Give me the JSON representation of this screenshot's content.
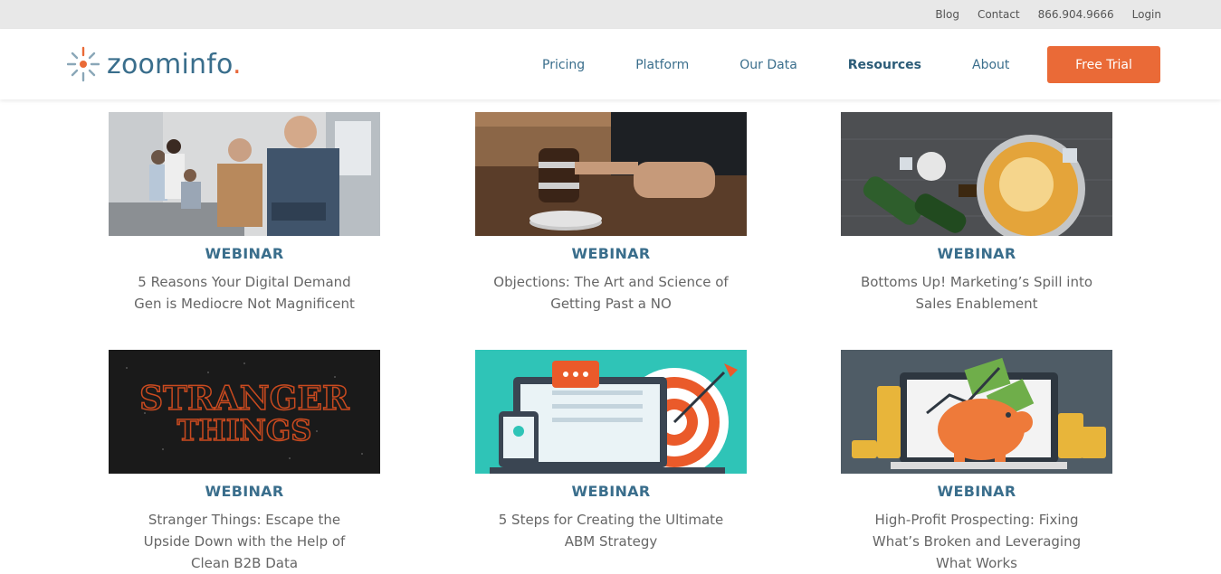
{
  "topbar": {
    "links": [
      {
        "label": "Blog"
      },
      {
        "label": "Contact"
      },
      {
        "label": "866.904.9666"
      },
      {
        "label": "Login"
      }
    ]
  },
  "header": {
    "logo_text": "zoominfo",
    "logo_dot": ".",
    "nav": [
      {
        "label": "Pricing"
      },
      {
        "label": "Platform"
      },
      {
        "label": "Our Data"
      },
      {
        "label": "Resources"
      },
      {
        "label": "About"
      }
    ],
    "cta_label": "Free Trial"
  },
  "colors": {
    "brand_blue": "#3a6e8c",
    "accent_orange": "#ea6a37"
  },
  "cards": [
    {
      "tag": "WEBINAR",
      "title": "5 Reasons Your Digital Demand Gen is Mediocre Not Magnificent",
      "image": "office-team-photo"
    },
    {
      "tag": "WEBINAR",
      "title": "Objections: The Art and Science of Getting Past a NO",
      "image": "gavel-photo"
    },
    {
      "tag": "WEBINAR",
      "title": "Bottoms Up! Marketing’s Spill into Sales Enablement",
      "image": "beer-glass-photo"
    },
    {
      "tag": "WEBINAR",
      "title": "Stranger Things: Escape the Upside Down with the Help of Clean B2B Data",
      "image": "stranger-things-title-art",
      "art_text_1": "STRANGER",
      "art_text_2": "THINGS"
    },
    {
      "tag": "WEBINAR",
      "title": "5 Steps for Creating the Ultimate ABM Strategy",
      "image": "abm-target-illustration"
    },
    {
      "tag": "WEBINAR",
      "title": "High-Profit Prospecting: Fixing What’s Broken and Leveraging What Works",
      "image": "piggy-bank-illustration"
    }
  ]
}
